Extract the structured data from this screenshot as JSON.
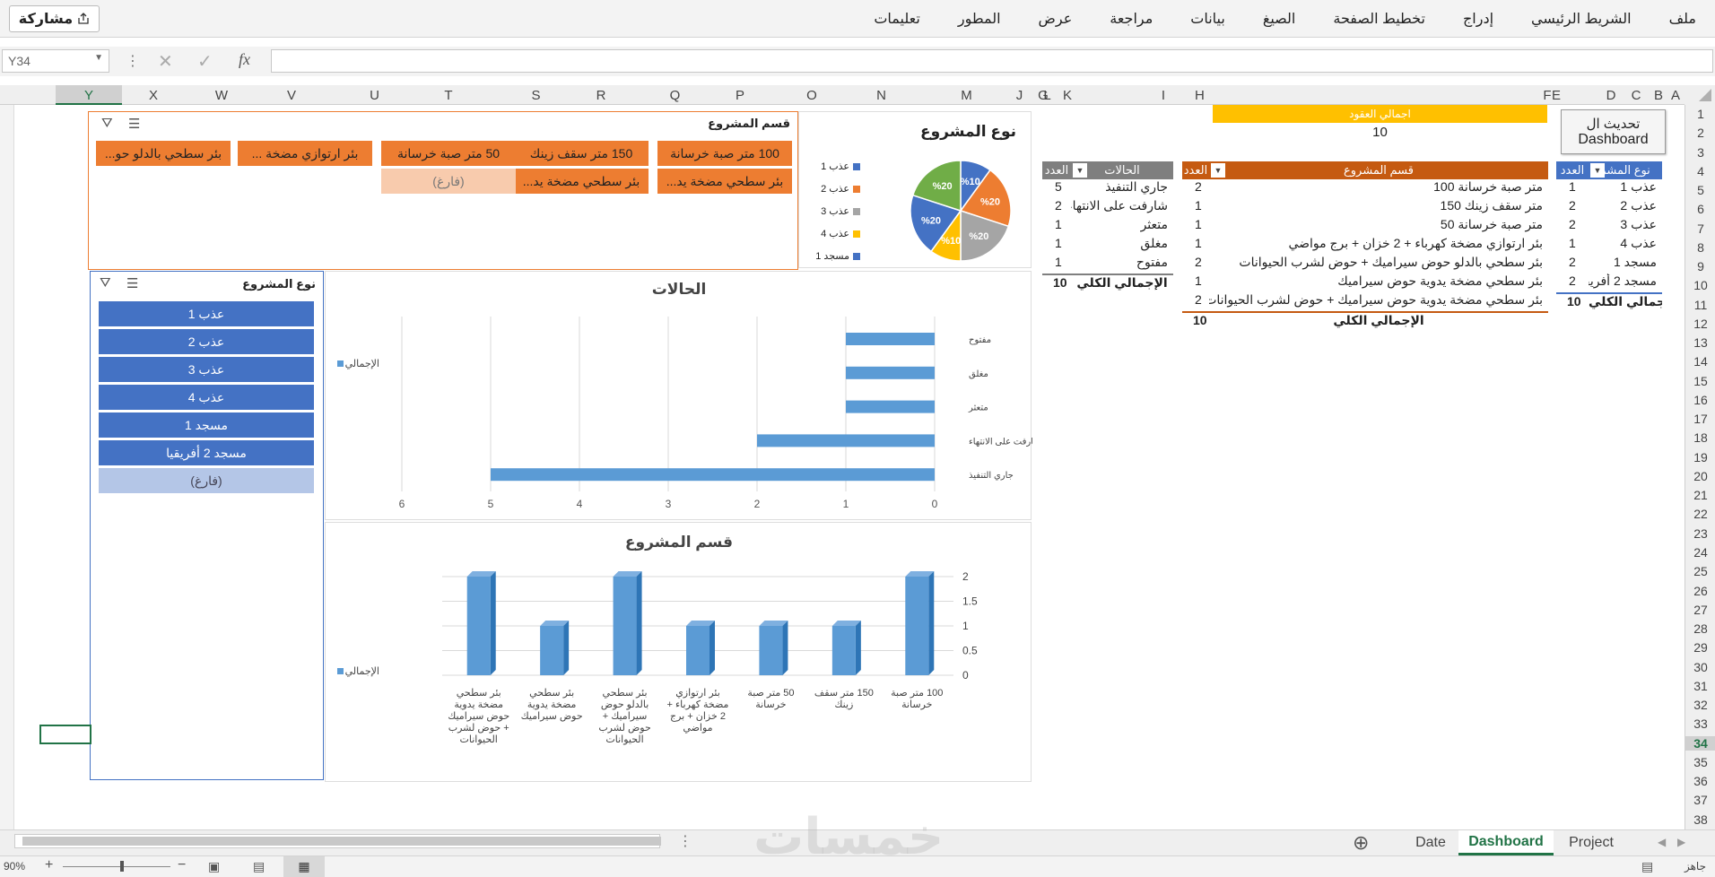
{
  "ribbon": {
    "share_label": "مشاركة",
    "tabs": [
      "ملف",
      "الشريط الرئيسي",
      "إدراج",
      "تخطيط الصفحة",
      "الصيغ",
      "بيانات",
      "مراجعة",
      "عرض",
      "المطور",
      "تعليمات"
    ]
  },
  "formula_bar": {
    "name_box": "Y34",
    "fx": "fx",
    "formula": ""
  },
  "columns": [
    "A",
    "B",
    "C",
    "D",
    "E",
    "F",
    "G",
    "H",
    "I",
    "J",
    "K",
    "L",
    "M",
    "N",
    "O",
    "P",
    "Q",
    "R",
    "S",
    "T",
    "U",
    "V",
    "W",
    "X",
    "Y"
  ],
  "rows": [
    "1",
    "2",
    "3",
    "4",
    "5",
    "6",
    "7",
    "8",
    "9",
    "10",
    "11",
    "12",
    "13",
    "14",
    "15",
    "16",
    "17",
    "18",
    "19",
    "20",
    "21",
    "22",
    "23",
    "24",
    "25",
    "26",
    "27",
    "28",
    "29",
    "30",
    "31",
    "32",
    "33",
    "34",
    "35",
    "36",
    "37",
    "38"
  ],
  "refresh_button": {
    "line1": "تحديث ال",
    "line2": "Dashboard"
  },
  "total_contracts": {
    "label": "اجمالي العقود",
    "value": "10"
  },
  "pivot_type": {
    "headers": [
      "نوع المشر",
      "العدد"
    ],
    "rows": [
      [
        "عذب 1",
        "1"
      ],
      [
        "عذب 2",
        "2"
      ],
      [
        "عذب 3",
        "2"
      ],
      [
        "عذب 4",
        "1"
      ],
      [
        "مسجد 1",
        "2"
      ],
      [
        "مسجد 2 أفريقيا",
        "2"
      ]
    ],
    "total_label": "الإجمالي الكلي",
    "total": "10"
  },
  "pivot_section": {
    "headers": [
      "قسم المشروع",
      "العدد"
    ],
    "rows": [
      [
        "متر صبة خرسانة 100",
        "2"
      ],
      [
        "متر سقف زينك 150",
        "1"
      ],
      [
        "متر صبة خرسانة 50",
        "1"
      ],
      [
        "بئر ارتوازي مضخة كهرباء + 2 خزان + برج مواضي",
        "1"
      ],
      [
        "بئر سطحي بالدلو حوض سيراميك + حوض لشرب الحيوانات",
        "2"
      ],
      [
        "بئر سطحي مضخة يدوية حوض سيراميك",
        "1"
      ],
      [
        "بئر سطحي مضخة يدوية حوض سيراميك + حوض لشرب الحيوانات",
        "2"
      ]
    ],
    "total_label": "الإجمالي الكلي",
    "total": "10"
  },
  "pivot_status": {
    "headers": [
      "الحالات",
      "العدد"
    ],
    "rows": [
      [
        "جاري التنفيذ",
        "5"
      ],
      [
        "شارفت على الانتهاء",
        "2"
      ],
      [
        "متعثر",
        "1"
      ],
      [
        "مغلق",
        "1"
      ],
      [
        "مفتوح",
        "1"
      ]
    ],
    "total_label": "الإجمالي الكلي",
    "total": "10"
  },
  "slicer_section": {
    "title": "قسم المشروع",
    "items": [
      "100 متر صبة خرسانة",
      "150 متر سقف زينك",
      "50 متر صبة خرسانة",
      "بئر ارتوازي مضخة ...",
      "بئر سطحي بالدلو حو...",
      "بئر سطحي مضخة يد...",
      "بئر سطحي مضخة يد...",
      "(فارغ)"
    ]
  },
  "slicer_type": {
    "title": "نوع المشروع",
    "items": [
      "عذب 1",
      "عذب 2",
      "عذب 3",
      "عذب 4",
      "مسجد 1",
      "مسجد 2 أفريقيا",
      "(فارغ)"
    ]
  },
  "colors": {
    "orange": "#ed7d31",
    "blue": "#4472c4",
    "gold": "#ffc000",
    "green": "#70ad47",
    "gray": "#a5a5a5",
    "excel_green": "#217346"
  },
  "chart_data": [
    {
      "type": "pie",
      "title": "نوع المشروع",
      "categories": [
        "عذب 1",
        "عذب 2",
        "عذب 3",
        "عذب 4",
        "مسجد 1"
      ],
      "values": [
        10,
        20,
        20,
        10,
        20
      ],
      "data_labels": [
        "%10",
        "%20",
        "%20",
        "%10",
        "%20"
      ],
      "extra_slice": {
        "value": 20,
        "label": "%20"
      },
      "colors": [
        "#4472c4",
        "#ed7d31",
        "#a5a5a5",
        "#ffc000",
        "#4472c4"
      ],
      "legend": "right"
    },
    {
      "type": "bar",
      "orientation": "horizontal",
      "title": "الحالات",
      "categories": [
        "مفتوح",
        "مغلق",
        "متعثر",
        "شارفت على الانتهاء",
        "جاري التنفيذ"
      ],
      "values": [
        1,
        1,
        1,
        2,
        5
      ],
      "xlim": [
        0,
        6
      ],
      "ticks": [
        "0",
        "1",
        "2",
        "3",
        "4",
        "5",
        "6"
      ],
      "legend": "الإجمالي",
      "grid": true
    },
    {
      "type": "bar",
      "title": "قسم المشروع",
      "categories": [
        "100 متر صبة خرسانة",
        "150 متر سقف زينك",
        "50 متر صبة خرسانة",
        "بئر ارتوازي مضخة كهرباء + 2 خزان + برج مواضي",
        "بئر سطحي بالدلو حوض سيراميك + حوض لشرب الحيوانات",
        "بئر سطحي مضخة يدوية حوض سيراميك",
        "بئر سطحي مضخة يدوية حوض سيراميك + حوض لشرب الحيوانات"
      ],
      "values": [
        2,
        1,
        1,
        1,
        2,
        1,
        2
      ],
      "ylim": [
        0,
        2
      ],
      "ticks": [
        "0",
        "0.5",
        "1",
        "1.5",
        "2"
      ],
      "legend": "الإجمالي"
    }
  ],
  "sheet_tabs": [
    "Project",
    "Dashboard",
    "Date"
  ],
  "active_tab": "Dashboard",
  "status": {
    "ready": "جاهز",
    "zoom": "90%"
  },
  "watermark": "خمسات"
}
